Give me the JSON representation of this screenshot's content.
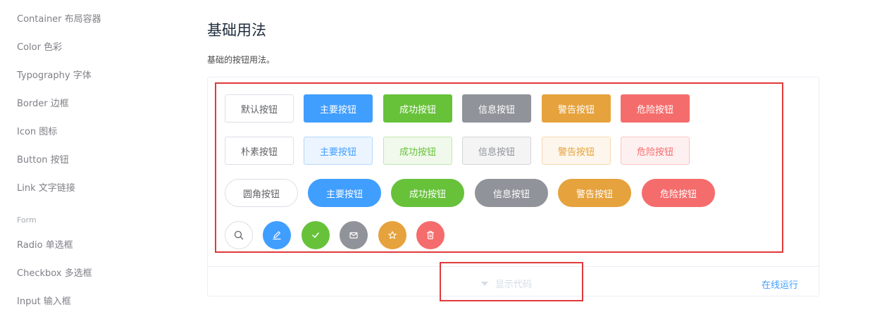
{
  "sidebar": {
    "items": [
      {
        "label": "Container 布局容器"
      },
      {
        "label": "Color 色彩"
      },
      {
        "label": "Typography 字体"
      },
      {
        "label": "Border 边框"
      },
      {
        "label": "Icon 图标"
      },
      {
        "label": "Button 按钮"
      },
      {
        "label": "Link 文字链接"
      }
    ],
    "group_title": "Form",
    "form_items": [
      {
        "label": "Radio 单选框"
      },
      {
        "label": "Checkbox 多选框"
      },
      {
        "label": "Input 输入框"
      }
    ]
  },
  "main": {
    "title": "基础用法",
    "description": "基础的按钮用法。",
    "row_default": [
      "默认按钮",
      "主要按钮",
      "成功按钮",
      "信息按钮",
      "警告按钮",
      "危险按钮"
    ],
    "row_plain": [
      "朴素按钮",
      "主要按钮",
      "成功按钮",
      "信息按钮",
      "警告按钮",
      "危险按钮"
    ],
    "row_round": [
      "圆角按钮",
      "主要按钮",
      "成功按钮",
      "信息按钮",
      "警告按钮",
      "危险按钮"
    ],
    "row_circle_icons": [
      "search-icon",
      "edit-icon",
      "check-icon",
      "message-icon",
      "star-icon",
      "delete-icon"
    ],
    "show_code": "显示代码",
    "run_online": "在线运行"
  },
  "colors": {
    "primary": "#409eff",
    "success": "#67c23a",
    "info": "#909399",
    "warning": "#e6a23c",
    "danger": "#f56c6c",
    "highlight": "#e0393a"
  }
}
